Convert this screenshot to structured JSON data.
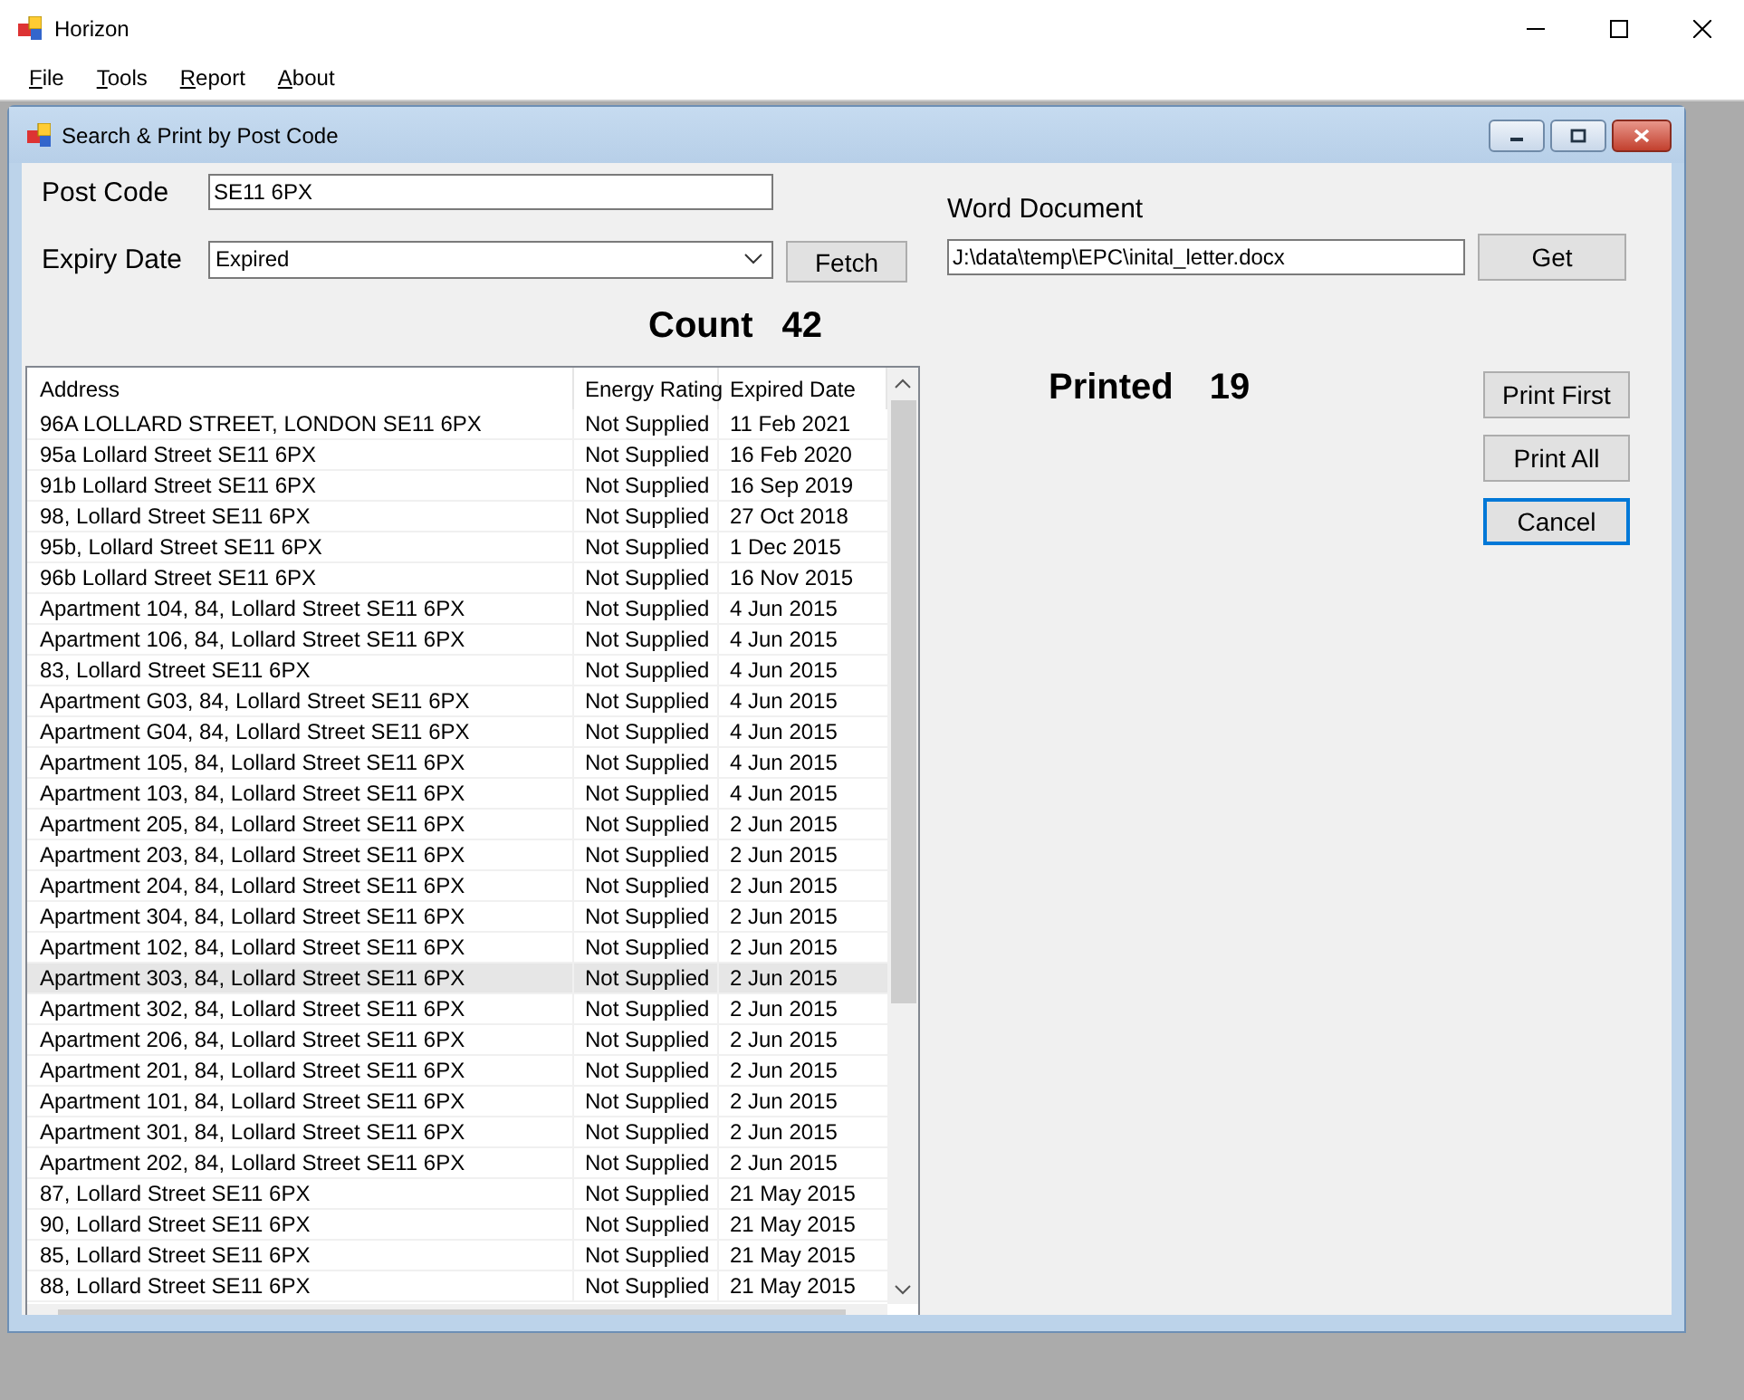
{
  "window": {
    "title": "Horizon"
  },
  "menu": [
    {
      "label": "File"
    },
    {
      "label": "Tools"
    },
    {
      "label": "Report"
    },
    {
      "label": "About"
    }
  ],
  "child_window": {
    "title": "Search & Print by Post Code"
  },
  "form": {
    "post_code": {
      "label": "Post Code",
      "value": "SE11 6PX"
    },
    "expiry_date": {
      "label": "Expiry Date",
      "value": "Expired"
    },
    "fetch_button": "Fetch",
    "count": {
      "label": "Count",
      "value": "42"
    },
    "word_document": {
      "label": "Word Document",
      "value": "J:\\data\\temp\\EPC\\inital_letter.docx"
    },
    "get_button": "Get",
    "printed": {
      "label": "Printed",
      "value": "19"
    }
  },
  "buttons": [
    {
      "label": "Print First",
      "focused": false
    },
    {
      "label": "Print All",
      "focused": false
    },
    {
      "label": "Cancel",
      "focused": true
    }
  ],
  "table": {
    "columns": [
      "Address",
      "Energy Rating",
      "Expired Date"
    ],
    "rows": [
      {
        "cells": [
          "96A LOLLARD STREET, LONDON SE11 6PX",
          "Not Supplied",
          "11 Feb 2021"
        ],
        "selected": false
      },
      {
        "cells": [
          "95a Lollard Street SE11 6PX",
          "Not Supplied",
          "16 Feb 2020"
        ],
        "selected": false
      },
      {
        "cells": [
          "91b Lollard Street SE11 6PX",
          "Not Supplied",
          "16 Sep 2019"
        ],
        "selected": false
      },
      {
        "cells": [
          "98, Lollard Street SE11 6PX",
          "Not Supplied",
          "27 Oct 2018"
        ],
        "selected": false
      },
      {
        "cells": [
          "95b, Lollard Street SE11 6PX",
          "Not Supplied",
          "1 Dec 2015"
        ],
        "selected": false
      },
      {
        "cells": [
          "96b Lollard Street SE11 6PX",
          "Not Supplied",
          "16 Nov 2015"
        ],
        "selected": false
      },
      {
        "cells": [
          "Apartment 104, 84, Lollard Street SE11 6PX",
          "Not Supplied",
          "4 Jun 2015"
        ],
        "selected": false
      },
      {
        "cells": [
          "Apartment 106, 84, Lollard Street SE11 6PX",
          "Not Supplied",
          "4 Jun 2015"
        ],
        "selected": false
      },
      {
        "cells": [
          "83, Lollard Street SE11 6PX",
          "Not Supplied",
          "4 Jun 2015"
        ],
        "selected": false
      },
      {
        "cells": [
          "Apartment G03, 84, Lollard Street SE11 6PX",
          "Not Supplied",
          "4 Jun 2015"
        ],
        "selected": false
      },
      {
        "cells": [
          "Apartment G04, 84, Lollard Street SE11 6PX",
          "Not Supplied",
          "4 Jun 2015"
        ],
        "selected": false
      },
      {
        "cells": [
          "Apartment 105, 84, Lollard Street SE11 6PX",
          "Not Supplied",
          "4 Jun 2015"
        ],
        "selected": false
      },
      {
        "cells": [
          "Apartment 103, 84, Lollard Street SE11 6PX",
          "Not Supplied",
          "4 Jun 2015"
        ],
        "selected": false
      },
      {
        "cells": [
          "Apartment 205, 84, Lollard Street SE11 6PX",
          "Not Supplied",
          "2 Jun 2015"
        ],
        "selected": false
      },
      {
        "cells": [
          "Apartment 203, 84, Lollard Street SE11 6PX",
          "Not Supplied",
          "2 Jun 2015"
        ],
        "selected": false
      },
      {
        "cells": [
          "Apartment 204, 84, Lollard Street SE11 6PX",
          "Not Supplied",
          "2 Jun 2015"
        ],
        "selected": false
      },
      {
        "cells": [
          "Apartment 304, 84, Lollard Street SE11 6PX",
          "Not Supplied",
          "2 Jun 2015"
        ],
        "selected": false
      },
      {
        "cells": [
          "Apartment 102, 84, Lollard Street SE11 6PX",
          "Not Supplied",
          "2 Jun 2015"
        ],
        "selected": false
      },
      {
        "cells": [
          "Apartment 303, 84, Lollard Street SE11 6PX",
          "Not Supplied",
          "2 Jun 2015"
        ],
        "selected": true
      },
      {
        "cells": [
          "Apartment 302, 84, Lollard Street SE11 6PX",
          "Not Supplied",
          "2 Jun 2015"
        ],
        "selected": false
      },
      {
        "cells": [
          "Apartment 206, 84, Lollard Street SE11 6PX",
          "Not Supplied",
          "2 Jun 2015"
        ],
        "selected": false
      },
      {
        "cells": [
          "Apartment 201, 84, Lollard Street SE11 6PX",
          "Not Supplied",
          "2 Jun 2015"
        ],
        "selected": false
      },
      {
        "cells": [
          "Apartment 101, 84, Lollard Street SE11 6PX",
          "Not Supplied",
          "2 Jun 2015"
        ],
        "selected": false
      },
      {
        "cells": [
          "Apartment 301, 84, Lollard Street SE11 6PX",
          "Not Supplied",
          "2 Jun 2015"
        ],
        "selected": false
      },
      {
        "cells": [
          "Apartment 202, 84, Lollard Street SE11 6PX",
          "Not Supplied",
          "2 Jun 2015"
        ],
        "selected": false
      },
      {
        "cells": [
          "87, Lollard Street SE11 6PX",
          "Not Supplied",
          "21 May 2015"
        ],
        "selected": false
      },
      {
        "cells": [
          "90, Lollard Street SE11 6PX",
          "Not Supplied",
          "21 May 2015"
        ],
        "selected": false
      },
      {
        "cells": [
          "85, Lollard Street SE11 6PX",
          "Not Supplied",
          "21 May 2015"
        ],
        "selected": false
      },
      {
        "cells": [
          "88, Lollard Street SE11 6PX",
          "Not Supplied",
          "21 May 2015"
        ],
        "selected": false
      }
    ]
  }
}
